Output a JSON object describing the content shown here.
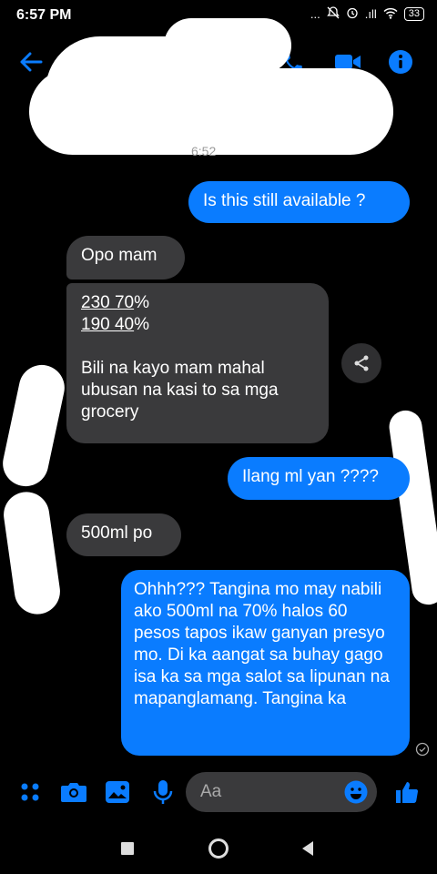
{
  "status_bar": {
    "time": "6:57 PM",
    "signal": ".ıll",
    "battery": "33",
    "dots": "..."
  },
  "header": {
    "icons": [
      "back-arrow-icon",
      "phone-icon",
      "video-icon",
      "info-icon"
    ]
  },
  "colors": {
    "accent": "#0a7cff",
    "incoming_bubble": "#3a3a3c",
    "background": "#000000"
  },
  "chat": {
    "timestamp": "6:52",
    "messages": [
      {
        "from": "me",
        "text": "Is this still available ?"
      },
      {
        "from": "them",
        "text": "Opo mam"
      },
      {
        "from": "them",
        "lines": [
          "230 70",
          "%",
          "190 40",
          "%"
        ],
        "text": "Bili na kayo mam mahal ubusan na kasi to sa mga grocery"
      },
      {
        "from": "me",
        "text": "Ilang ml yan ????"
      },
      {
        "from": "them",
        "text": "500ml po"
      },
      {
        "from": "me",
        "text": "Ohhh??? Tangina mo may nabili ako 500ml na 70% halos 60 pesos tapos ikaw ganyan presyo mo. Di ka aangat sa buhay gago isa ka sa mga salot sa lipunan na mapanglamang.  Tangina ka"
      }
    ]
  },
  "composer": {
    "placeholder": "Aa"
  }
}
